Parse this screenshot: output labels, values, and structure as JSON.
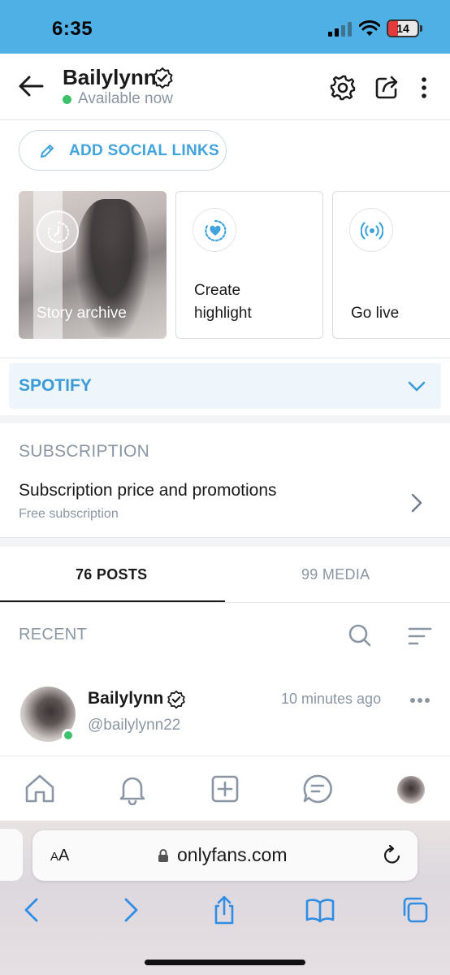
{
  "status_bar": {
    "time": "6:35",
    "battery": "14"
  },
  "header": {
    "name": "Bailylynn",
    "availability": "Available now"
  },
  "social": {
    "label": "ADD SOCIAL LINKS"
  },
  "cards": {
    "story_archive": "Story archive",
    "create_highlight_line1": "Create",
    "create_highlight_line2": "highlight",
    "go_live": "Go live"
  },
  "spotify": {
    "label": "SPOTIFY"
  },
  "subscription": {
    "section_title": "SUBSCRIPTION",
    "row_title": "Subscription price and promotions",
    "row_subtitle": "Free subscription"
  },
  "tabs": {
    "posts": "76 POSTS",
    "media": "99 MEDIA"
  },
  "recent": {
    "label": "RECENT"
  },
  "post": {
    "name": "Bailylynn",
    "handle": "@bailylynn22",
    "time": "10 minutes ago"
  },
  "browser": {
    "aa_label_small": "A",
    "aa_label": "A",
    "url": "onlyfans.com"
  },
  "colors": {
    "accent": "#41a3dc",
    "status_bar": "#4fb0e6",
    "online": "#3ec16b",
    "muted": "#8a96a3"
  },
  "icons": [
    "back-arrow-icon",
    "verified-icon",
    "gear-icon",
    "share-icon",
    "more-vertical-icon",
    "pencil-icon",
    "clock-icon",
    "heart-icon",
    "broadcast-icon",
    "chevron-down-icon",
    "chevron-right-icon",
    "search-icon",
    "sort-icon",
    "more-horizontal-icon",
    "home-icon",
    "bell-icon",
    "plus-square-icon",
    "message-icon",
    "lock-icon",
    "reload-icon",
    "back-icon",
    "forward-icon",
    "share-sheet-icon",
    "bookmarks-icon",
    "tabs-icon"
  ]
}
